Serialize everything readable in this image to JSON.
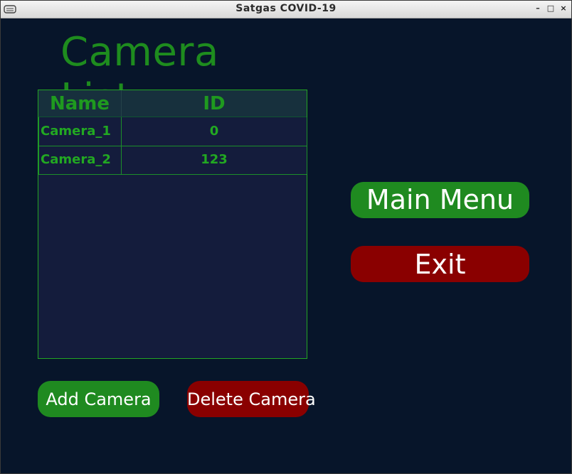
{
  "window": {
    "title": "Satgas COVID-19",
    "min_symbol": "–",
    "max_symbol": "□",
    "close_symbol": "×"
  },
  "page": {
    "heading": "Camera List"
  },
  "camera_table": {
    "columns": [
      "Name",
      "ID"
    ],
    "rows": [
      {
        "name": "Camera_1",
        "id": "0"
      },
      {
        "name": "Camera_2",
        "id": "123"
      }
    ]
  },
  "buttons": {
    "main_menu": "Main Menu",
    "exit": "Exit",
    "add_camera": "Add Camera",
    "delete_camera": "Delete Camera"
  },
  "colors": {
    "background": "#07152a",
    "accent_green": "#1f8a20",
    "danger_red": "#8a0000",
    "text_green": "#22a822"
  }
}
